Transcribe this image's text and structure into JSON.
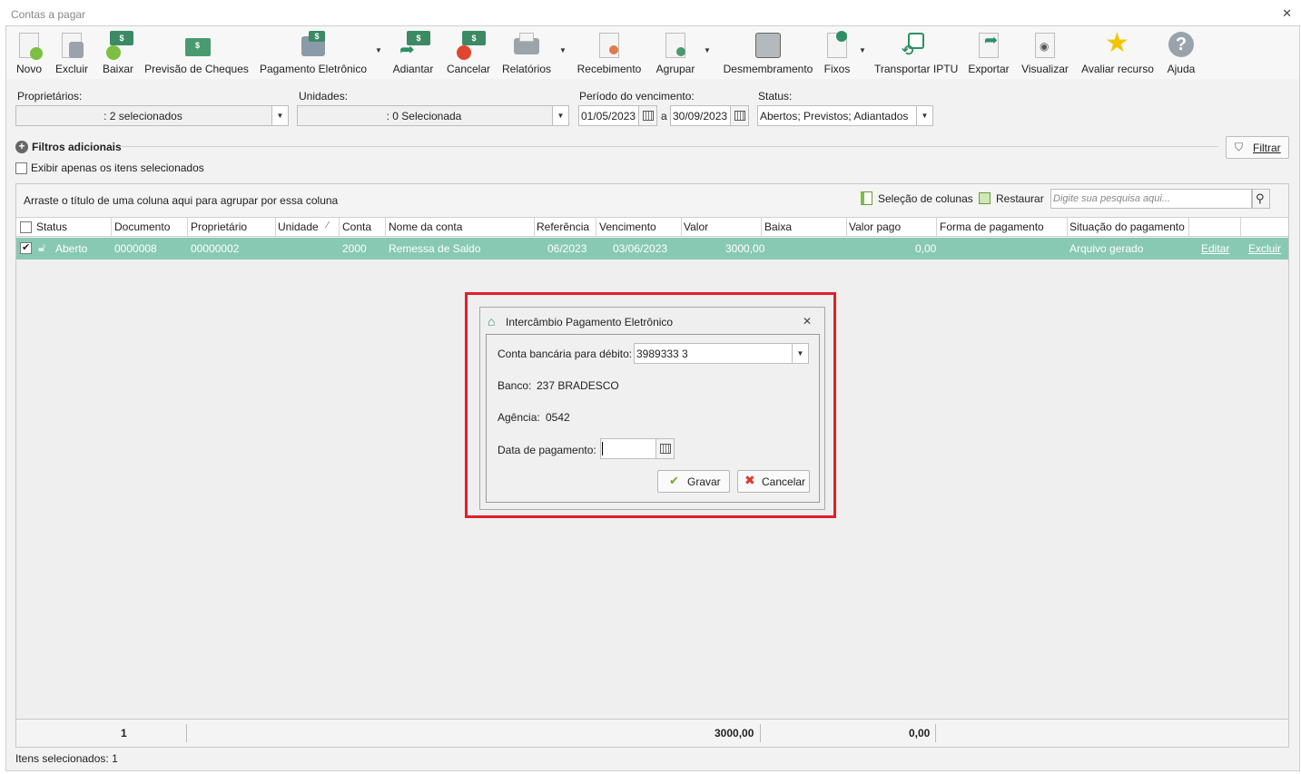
{
  "window": {
    "title": "Contas a pagar"
  },
  "toolbar": {
    "items": [
      {
        "label": "Novo",
        "icon": "new-document-icon"
      },
      {
        "label": "Excluir",
        "icon": "trash-icon"
      },
      {
        "label": "Baixar",
        "icon": "money-check-icon"
      },
      {
        "label": "Previsão de Cheques",
        "icon": "cheque-icon"
      },
      {
        "label": "Pagamento Eletrônico",
        "icon": "electronic-payment-icon"
      },
      {
        "label": "Adiantar",
        "icon": "advance-payment-icon"
      },
      {
        "label": "Cancelar",
        "icon": "cancel-payment-icon"
      },
      {
        "label": "Relatórios",
        "icon": "printer-icon"
      },
      {
        "label": "Recebimento",
        "icon": "receipt-icon"
      },
      {
        "label": "Agrupar",
        "icon": "group-icon"
      },
      {
        "label": "Desmembramento",
        "icon": "split-icon"
      },
      {
        "label": "Fixos",
        "icon": "pin-icon"
      },
      {
        "label": "Transportar IPTU",
        "icon": "transport-iptu-icon"
      },
      {
        "label": "Exportar",
        "icon": "export-icon"
      },
      {
        "label": "Visualizar",
        "icon": "eye-icon"
      },
      {
        "label": "Avaliar recurso",
        "icon": "star-icon"
      },
      {
        "label": "Ajuda",
        "icon": "help-icon"
      }
    ]
  },
  "filters": {
    "owners_label": "Proprietários:",
    "owners_value": ": 2 selecionados",
    "units_label": "Unidades:",
    "units_value": ": 0 Selecionada",
    "period_label": "Período do vencimento:",
    "date_from": "01/05/2023",
    "date_sep": "a",
    "date_to": "30/09/2023",
    "status_label": "Status:",
    "status_value": "Abertos; Previstos; Adiantados",
    "extra_filters": "Filtros adicionais",
    "only_selected": "Exibir apenas os itens selecionados",
    "filter_button": "Filtrar"
  },
  "grid": {
    "group_hint": "Arraste o título de uma coluna aqui para agrupar por essa coluna",
    "column_selection": "Seleção de colunas",
    "restore": "Restaurar",
    "search_placeholder": "Digite sua pesquisa aqui...",
    "columns": [
      "Status",
      "Documento",
      "Proprietário",
      "Unidade",
      "Conta",
      "Nome da conta",
      "Referência",
      "Vencimento",
      "Valor",
      "Baixa",
      "Valor pago",
      "Forma de pagamento",
      "Situação do pagamento"
    ],
    "rows": [
      {
        "status": "Aberto",
        "documento": "0000008",
        "proprietario": "00000002",
        "unidade": "",
        "conta": "2000",
        "nome_conta": "Remessa de Saldo",
        "referencia": "06/2023",
        "vencimento": "03/06/2023",
        "valor": "3000,00",
        "baixa": "",
        "valor_pago": "0,00",
        "forma_pagamento": "",
        "situacao": "Arquivo gerado",
        "edit": "Editar",
        "delete": "Excluir",
        "selected": true
      }
    ],
    "footer": {
      "count": "1",
      "total_valor": "3000,00",
      "total_pago": "0,00"
    }
  },
  "status_bar": {
    "text": "Itens selecionados: 1"
  },
  "dialog": {
    "title": "Intercâmbio Pagamento Eletrônico",
    "account_label": "Conta bancária para débito:",
    "account_value": "3989333 3",
    "bank_label": "Banco:",
    "bank_value": "237 BRADESCO",
    "agency_label": "Agência:",
    "agency_value": "0542",
    "date_label": "Data de pagamento:",
    "date_value": "",
    "save": "Gravar",
    "cancel": "Cancelar"
  },
  "colors": {
    "row_selected": "#88c9b3",
    "highlight": "#e01f2b",
    "accent_green": "#3b8a64"
  }
}
